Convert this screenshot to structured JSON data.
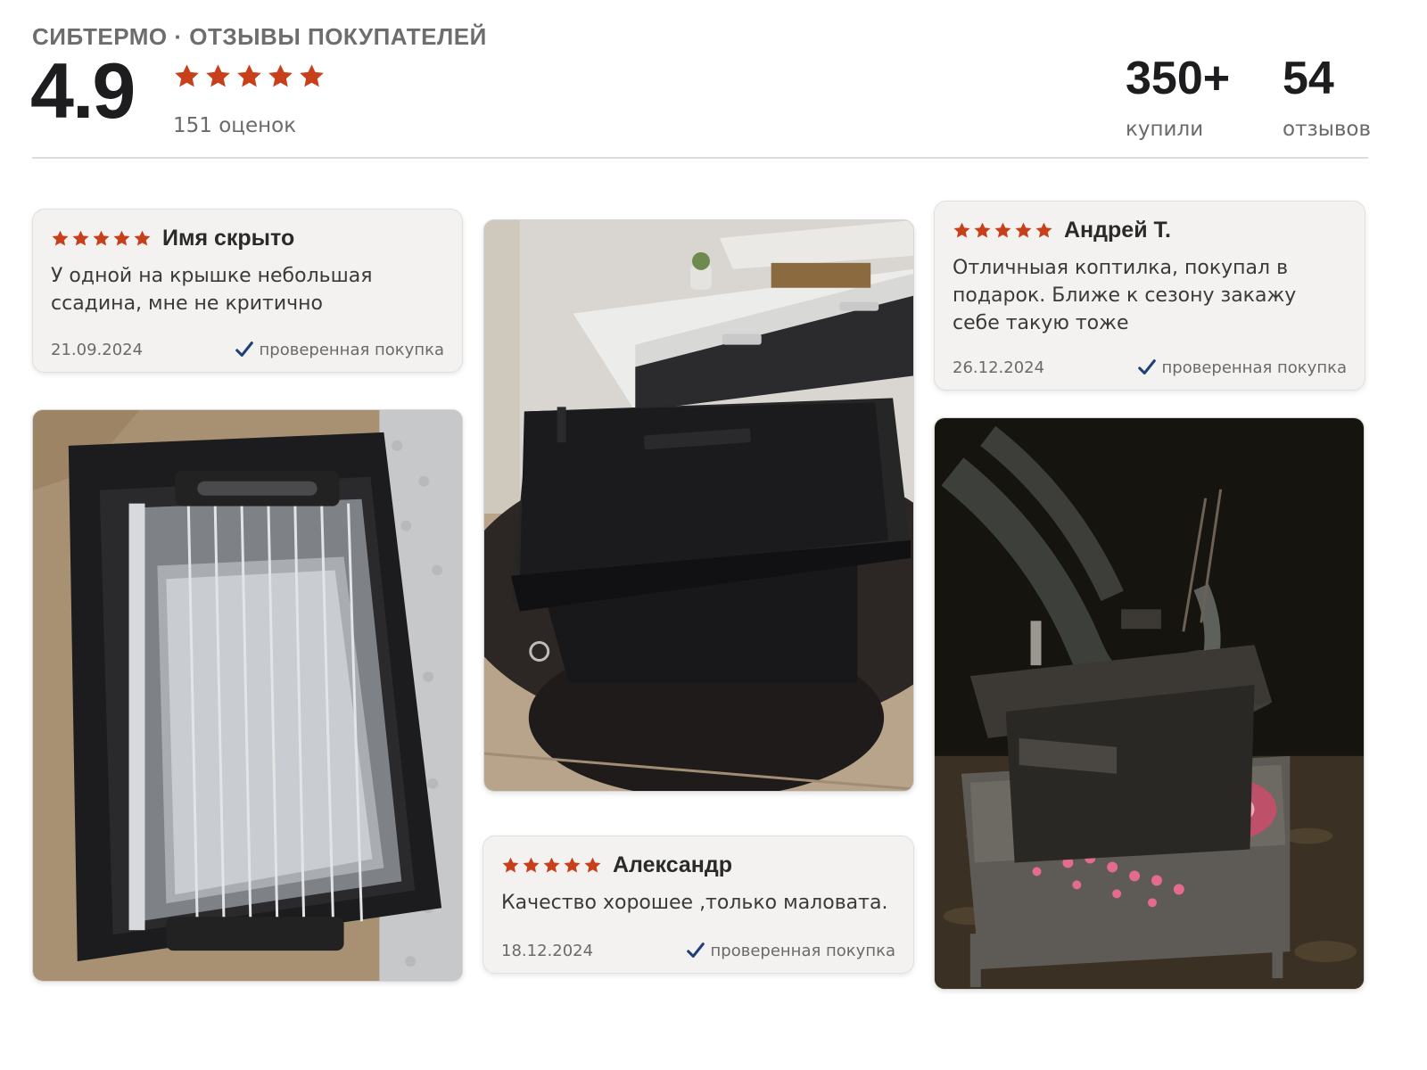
{
  "header": {
    "brand_line": "СИБТЕРМО · ОТЗЫВЫ ПОКУПАТЕЛЕЙ",
    "rating": "4.9",
    "rating_count": "151 оценок",
    "stars": 5,
    "bought_count": "350+",
    "bought_label": "купили",
    "reviews_count": "54",
    "reviews_label": "отзывов"
  },
  "reviews": [
    {
      "name": "Имя скрыто",
      "stars": 5,
      "text": "У одной на крышке небольшая ссадина, мне не критично",
      "date": "21.09.2024",
      "verified": "проверенная покупка"
    },
    {
      "name": "Александр",
      "stars": 5,
      "text": "Качество хорошее ,только маловата.",
      "date": "18.12.2024",
      "verified": "проверенная покупка"
    },
    {
      "name": "Андрей Т.",
      "stars": 5,
      "text": "Отличныая коптилка, покупал в подарок. Ближе к сезону закажу себе такую тоже",
      "date": "26.12.2024",
      "verified": "проверенная покупка"
    }
  ],
  "photos": [
    {
      "name": "photo-open-smoker-box"
    },
    {
      "name": "photo-smoker-on-table"
    },
    {
      "name": "photo-smoker-on-grill-night"
    }
  ],
  "colors": {
    "star": "#c8401b",
    "check": "#1f3f7a",
    "card_bg": "#f3f2f0"
  },
  "icons": {
    "star": "star-icon",
    "verified": "check-icon"
  }
}
